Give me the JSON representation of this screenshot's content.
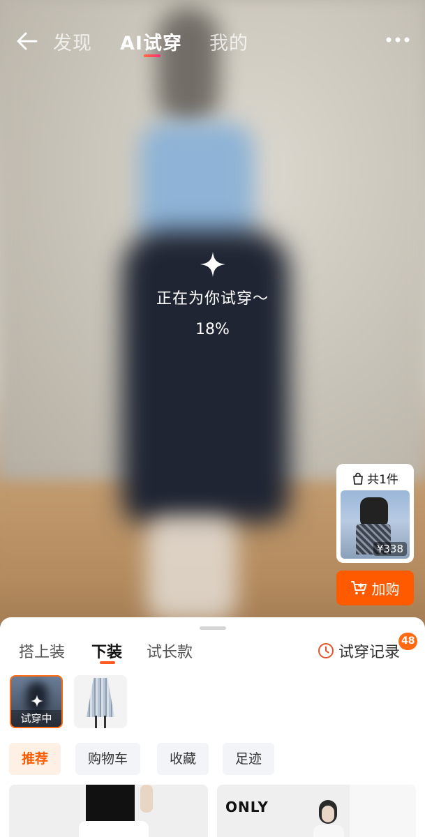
{
  "nav": {
    "tabs": [
      {
        "label": "发现",
        "active": false
      },
      {
        "label": "AI试穿",
        "active": true
      },
      {
        "label": "我的",
        "active": false
      }
    ],
    "back_icon": "arrow-left-icon",
    "more_icon": "more-dots-icon"
  },
  "progress": {
    "message": "正在为你试穿～",
    "percent_text": "18%",
    "percent": 18,
    "icon": "sparkle-icon"
  },
  "cart": {
    "count_label": "共1件",
    "price": "¥338",
    "add_label": "加购",
    "accent_color": "#ff5a00"
  },
  "sheet": {
    "categories": [
      {
        "label": "搭上装",
        "active": false
      },
      {
        "label": "下装",
        "active": true
      },
      {
        "label": "试长款",
        "active": false
      }
    ],
    "history_label": "试穿记录",
    "history_badge": "48",
    "trying_label": "试穿中",
    "filters": [
      {
        "label": "推荐",
        "active": true
      },
      {
        "label": "购物车",
        "active": false
      },
      {
        "label": "收藏",
        "active": false
      },
      {
        "label": "足迹",
        "active": false
      }
    ],
    "product_brand": "ONLY"
  }
}
